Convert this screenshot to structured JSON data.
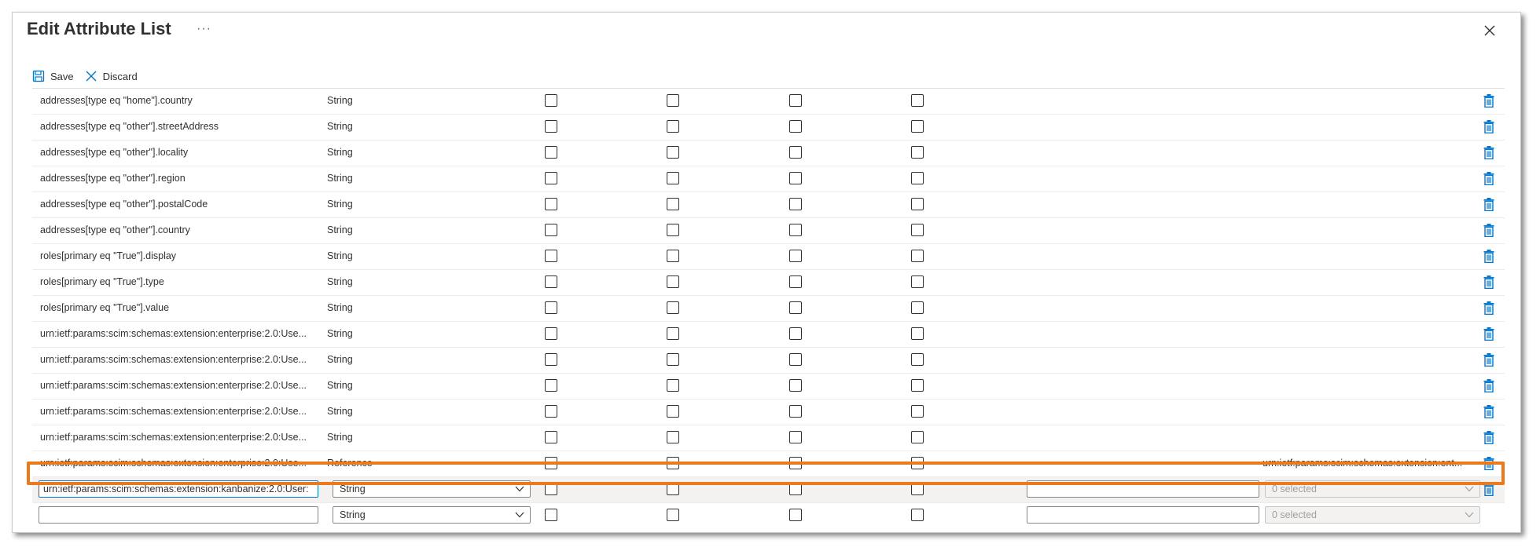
{
  "header": {
    "title": "Edit Attribute List",
    "more_label": "···"
  },
  "toolbar": {
    "save_label": "Save",
    "discard_label": "Discard"
  },
  "rows": [
    {
      "name": "addresses[type eq \"home\"].country",
      "type": "String"
    },
    {
      "name": "addresses[type eq \"other\"].streetAddress",
      "type": "String"
    },
    {
      "name": "addresses[type eq \"other\"].locality",
      "type": "String"
    },
    {
      "name": "addresses[type eq \"other\"].region",
      "type": "String"
    },
    {
      "name": "addresses[type eq \"other\"].postalCode",
      "type": "String"
    },
    {
      "name": "addresses[type eq \"other\"].country",
      "type": "String"
    },
    {
      "name": "roles[primary eq \"True\"].display",
      "type": "String"
    },
    {
      "name": "roles[primary eq \"True\"].type",
      "type": "String"
    },
    {
      "name": "roles[primary eq \"True\"].value",
      "type": "String"
    },
    {
      "name": "urn:ietf:params:scim:schemas:extension:enterprise:2.0:Use...",
      "type": "String"
    },
    {
      "name": "urn:ietf:params:scim:schemas:extension:enterprise:2.0:Use...",
      "type": "String"
    },
    {
      "name": "urn:ietf:params:scim:schemas:extension:enterprise:2.0:Use...",
      "type": "String"
    },
    {
      "name": "urn:ietf:params:scim:schemas:extension:enterprise:2.0:Use...",
      "type": "String"
    },
    {
      "name": "urn:ietf:params:scim:schemas:extension:enterprise:2.0:Use...",
      "type": "String"
    },
    {
      "name": "urn:ietf:params:scim:schemas:extension:enterprise:2.0:Use...",
      "type": "Reference",
      "referenced": "urn:ietf:params:scim:schemas:extension:ent..."
    }
  ],
  "editing_row": {
    "name_value": "urn:ietf:params:scim:schemas:extension:kanbanize:2.0:User:",
    "type_value": "String",
    "default_value": "",
    "referenced_value": "0 selected"
  },
  "new_row": {
    "name_value": "",
    "type_value": "String",
    "default_value": "",
    "referenced_value": "0 selected"
  },
  "colors": {
    "accent": "#0078d4",
    "highlight": "#ea7a1c",
    "trash": "#0078d4"
  }
}
